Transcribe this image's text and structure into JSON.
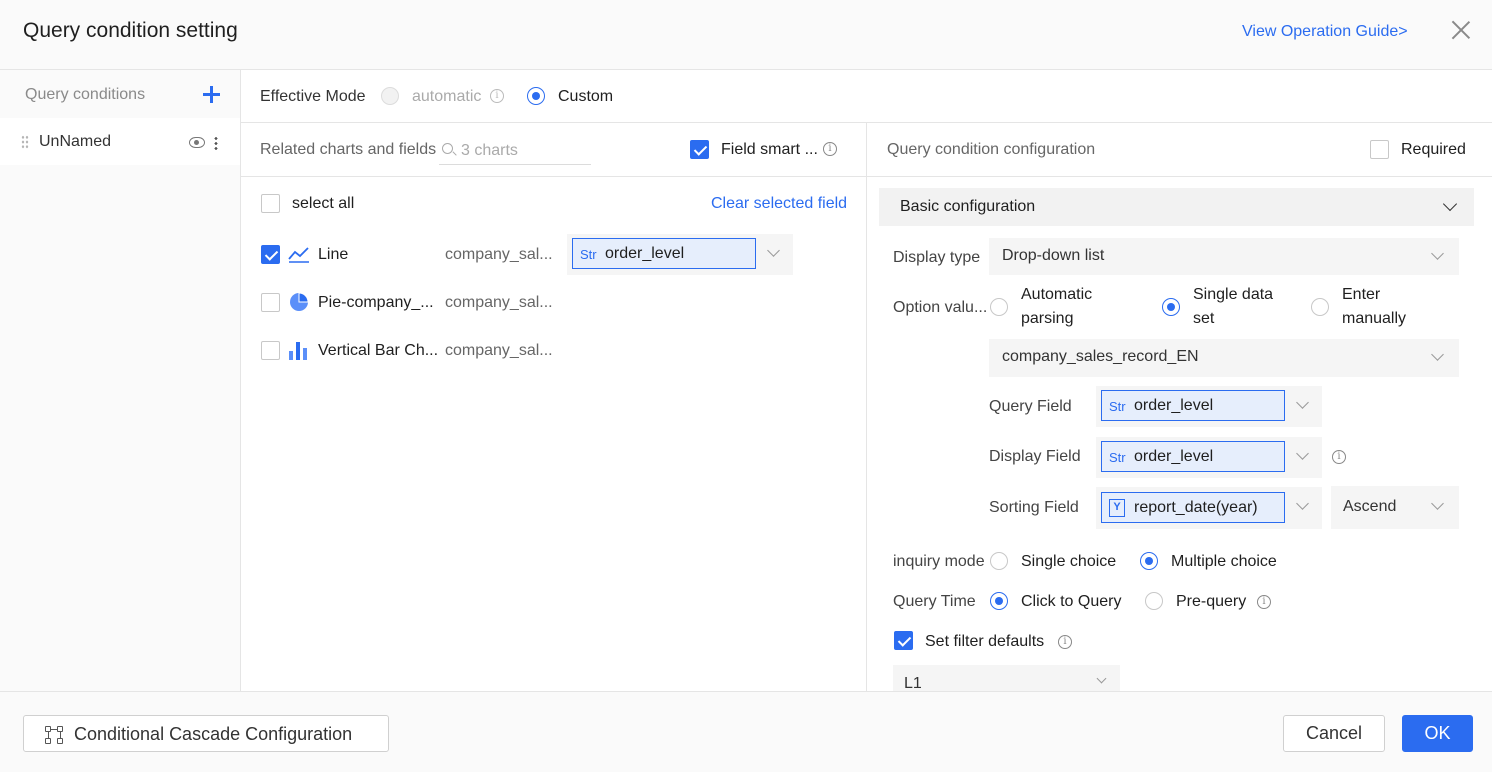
{
  "header": {
    "title": "Query condition setting",
    "guide_link": "View Operation Guide>"
  },
  "sidebar": {
    "title": "Query conditions",
    "items": [
      {
        "label": "UnNamed"
      }
    ]
  },
  "effective_mode": {
    "label": "Effective Mode",
    "options": [
      {
        "label": "automatic",
        "selected": false,
        "disabled": true
      },
      {
        "label": "Custom",
        "selected": true,
        "disabled": false
      }
    ]
  },
  "related": {
    "label": "Related charts and fields",
    "search_placeholder": "3 charts",
    "field_smart_label": "Field smart ...",
    "field_smart_checked": true,
    "select_all_label": "select all",
    "clear_label": "Clear selected field",
    "charts": [
      {
        "name": "Line",
        "dataset": "company_sal...",
        "checked": true,
        "icon": "line-chart-icon",
        "field_type": "Str",
        "field": "order_level"
      },
      {
        "name": "Pie-company_...",
        "dataset": "company_sal...",
        "checked": false,
        "icon": "pie-chart-icon"
      },
      {
        "name": "Vertical Bar Ch...",
        "dataset": "company_sal...",
        "checked": false,
        "icon": "bar-chart-icon"
      }
    ]
  },
  "config": {
    "title": "Query condition configuration",
    "required_label": "Required",
    "required_checked": false,
    "basic_label": "Basic configuration",
    "display_type_label": "Display type",
    "display_type_value": "Drop-down list",
    "option_value_label": "Option valu...",
    "option_sources": [
      {
        "line1": "Automatic",
        "line2": "parsing",
        "selected": false
      },
      {
        "line1": "Single data",
        "line2": "set",
        "selected": true
      },
      {
        "line1": "Enter",
        "line2": "manually",
        "selected": false
      }
    ],
    "dataset_value": "company_sales_record_EN",
    "query_field_label": "Query Field",
    "query_field_type": "Str",
    "query_field_value": "order_level",
    "display_field_label": "Display Field",
    "display_field_type": "Str",
    "display_field_value": "order_level",
    "sorting_field_label": "Sorting Field",
    "sorting_field_type": "Y",
    "sorting_field_value": "report_date(year)",
    "sort_order_value": "Ascend",
    "inquiry_mode_label": "inquiry mode",
    "inquiry_options": [
      {
        "label": "Single choice",
        "selected": false
      },
      {
        "label": "Multiple choice",
        "selected": true
      }
    ],
    "query_time_label": "Query Time",
    "query_time_options": [
      {
        "label": "Click to Query",
        "selected": true
      },
      {
        "label": "Pre-query",
        "selected": false
      }
    ],
    "filter_defaults_label": "Set filter defaults",
    "filter_defaults_checked": true,
    "default_value": "L1"
  },
  "footer": {
    "cascade_label": "Conditional Cascade Configuration",
    "cancel_label": "Cancel",
    "ok_label": "OK"
  },
  "colors": {
    "accent": "#2b6cf0",
    "chip_bg": "#e6eefc"
  }
}
